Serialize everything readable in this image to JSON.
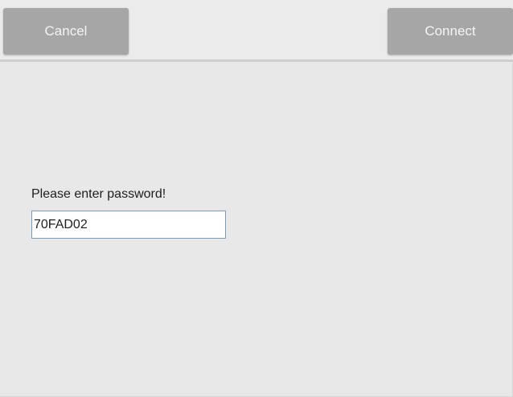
{
  "toolbar": {
    "cancel_label": "Cancel",
    "connect_label": "Connect"
  },
  "password_prompt": {
    "label": "Please enter password!",
    "value": "70FAD02"
  },
  "colors": {
    "background": "#e8e8e8",
    "button_fill": "#a6a6a6",
    "button_text": "#f4f4f4",
    "field_border": "#7a9cc4"
  }
}
